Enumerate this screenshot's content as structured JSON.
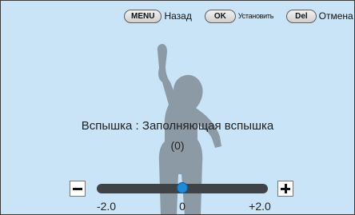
{
  "topbar": {
    "menu_key": "MENU",
    "menu_label": "Назад",
    "ok_key": "OK",
    "ok_label": "Установить",
    "del_key": "Del",
    "del_label": "Отмена"
  },
  "flash": {
    "title": "Вспышка : Заполняющая вспышка",
    "value_display": "(0)"
  },
  "slider": {
    "min": -2.0,
    "max": 2.0,
    "value": 0,
    "min_label": "-2.0",
    "mid_label": "0",
    "max_label": "+2.0",
    "accent_color": "#1f8bd6"
  },
  "colors": {
    "background": "#c9e3f7",
    "silhouette": "#8c9aa5"
  }
}
